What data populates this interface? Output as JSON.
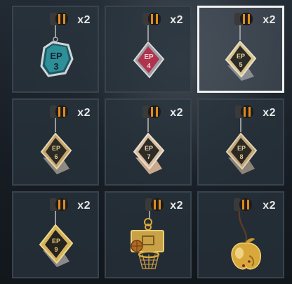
{
  "inventory": {
    "items": [
      {
        "name": "EP 3 charm",
        "count": "x2",
        "line1": "EP",
        "line2": "3",
        "selected": false
      },
      {
        "name": "EP 4 charm",
        "count": "x2",
        "line1": "EP",
        "line2": "4",
        "selected": false
      },
      {
        "name": "EP 5 charm",
        "count": "x2",
        "line1": "EP",
        "line2": "5",
        "selected": true
      },
      {
        "name": "EP 6 charm",
        "count": "x2",
        "line1": "EP",
        "line2": "6",
        "selected": false
      },
      {
        "name": "EP 7 charm",
        "count": "x2",
        "line1": "EP",
        "line2": "7",
        "selected": false
      },
      {
        "name": "EP 8 charm",
        "count": "x2",
        "line1": "EP",
        "line2": "8",
        "selected": false
      },
      {
        "name": "EP 9 charm",
        "count": "x2",
        "line1": "EP",
        "line2": "9",
        "selected": false
      },
      {
        "name": "Basketball hoop charm",
        "count": "x2",
        "icon": "basketball-hoop-icon",
        "selected": false
      },
      {
        "name": "Golden apple charm",
        "count": "x2",
        "icon": "golden-apple-icon",
        "selected": false
      }
    ]
  },
  "colors": {
    "ep3": "#2f8f98",
    "ep4": "#b0324c",
    "metal": "#c6a36a",
    "gold": "#d8a93a",
    "accent_orange": "#e08a1e"
  }
}
